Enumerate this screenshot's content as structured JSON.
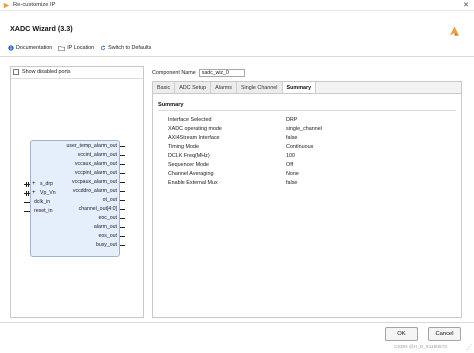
{
  "window": {
    "title": "Re-customize IP"
  },
  "header": {
    "ip_name": "XADC Wizard (3.3)",
    "toolbar": {
      "documentation_label": "Documentation",
      "ip_location_label": "IP Location",
      "switch_defaults_label": "Switch to Defaults"
    }
  },
  "left_panel": {
    "show_disabled_ports_label": "Show disabled ports",
    "symbol": {
      "left_ports": [
        {
          "label": "s_drp",
          "bus": true
        },
        {
          "label": "Vp_Vn",
          "bus": true
        },
        {
          "label": "dclk_in",
          "bus": false
        },
        {
          "label": "reset_in",
          "bus": false
        }
      ],
      "right_ports": [
        "user_temp_alarm_out",
        "vccint_alarm_out",
        "vccaux_alarm_out",
        "vccpint_alarm_out",
        "vccpaux_alarm_out",
        "vccddro_alarm_out",
        "ot_out",
        "channel_out[4:0]",
        "eoc_out",
        "alarm_out",
        "eos_out",
        "busy_out"
      ]
    }
  },
  "right_panel": {
    "component_name_label": "Component Name",
    "component_name_value": "xadc_wiz_0",
    "tabs": [
      {
        "label": "Basic",
        "active": false
      },
      {
        "label": "ADC Setup",
        "active": false
      },
      {
        "label": "Alarms",
        "active": false
      },
      {
        "label": "Single Channel",
        "active": false
      },
      {
        "label": "Summary",
        "active": true
      }
    ],
    "summary": {
      "title": "Summary",
      "rows": [
        {
          "key": "Interface Selected",
          "value": "DRP"
        },
        {
          "key": "XADC operating mode",
          "value": "single_channel"
        },
        {
          "key": "AXI4Stream Interface",
          "value": "false"
        },
        {
          "key": "Timing Mode",
          "value": "Continuous"
        },
        {
          "key": "DCLK Freq(MHz)",
          "value": "100"
        },
        {
          "key": "Sequencer Mode",
          "value": "Off"
        },
        {
          "key": "Channel Averaging",
          "value": "None"
        },
        {
          "key": "Enable External Mux",
          "value": "false"
        }
      ]
    }
  },
  "footer": {
    "ok_label": "OK",
    "cancel_label": "Cancel"
  },
  "watermark": "CSDN @H_D_51190672",
  "colors": {
    "symbol_fill": "#e5eefb",
    "symbol_border": "#9fb4d0",
    "logo_orange": "#e8a33c"
  }
}
